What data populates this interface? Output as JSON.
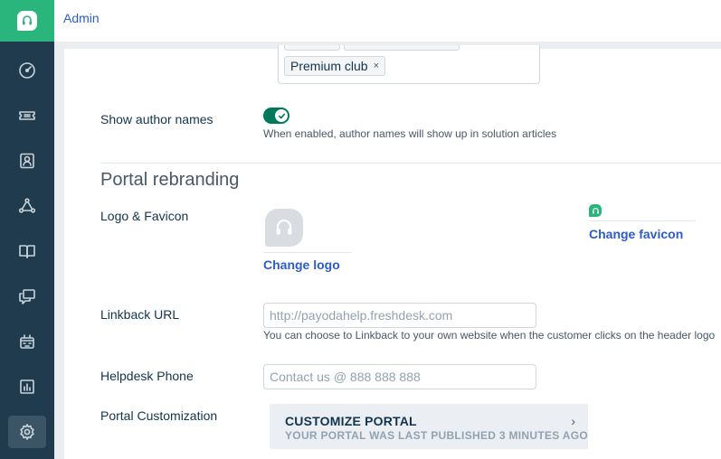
{
  "topbar": {
    "title": "Admin"
  },
  "sidebar": {
    "items": [
      {
        "icon": "dashboard-icon"
      },
      {
        "icon": "tickets-icon"
      },
      {
        "icon": "contacts-icon"
      },
      {
        "icon": "social-icon"
      },
      {
        "icon": "solutions-icon"
      },
      {
        "icon": "forums-icon"
      },
      {
        "icon": "bot-icon"
      },
      {
        "icon": "reports-icon"
      },
      {
        "icon": "admin-gear-icon",
        "active": true
      }
    ]
  },
  "tags": {
    "visible_tag": "Premium club",
    "remove_glyph": "×"
  },
  "author_names": {
    "label": "Show author names",
    "enabled": true,
    "help": "When enabled, author names will show up in solution articles"
  },
  "rebranding": {
    "title": "Portal rebranding",
    "logo_label": "Logo & Favicon",
    "change_logo": "Change logo",
    "change_favicon": "Change favicon"
  },
  "linkback": {
    "label": "Linkback URL",
    "placeholder": "http://payodahelp.freshdesk.com",
    "help": "You can choose to Linkback to your own website when the customer clicks on the header logo"
  },
  "phone": {
    "label": "Helpdesk Phone",
    "placeholder": "Contact us @ 888 888 888"
  },
  "customization": {
    "label": "Portal Customization",
    "button_title": "CUSTOMIZE PORTAL",
    "button_subtitle": "YOUR PORTAL WAS LAST PUBLISHED 3 MINUTES AGO",
    "chevron": "›"
  },
  "colors": {
    "brand": "#2ab57d",
    "sidebar": "#1f3b4d",
    "link": "#2c5cc5",
    "toggle": "#00795b"
  }
}
